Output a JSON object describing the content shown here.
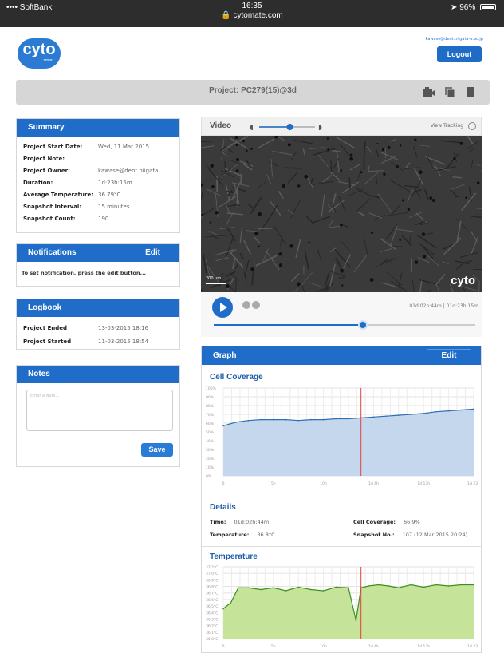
{
  "status_bar": {
    "carrier": "•••• SoftBank",
    "time": "16:35",
    "url": "cytomate.com",
    "battery": "96%"
  },
  "header": {
    "logo_text": "cyto",
    "logo_sub": "smart",
    "user_email": "kawase@dent.niigata-u.ac.jp",
    "logout_label": "Logout"
  },
  "project": {
    "title": "Project: PC279(15)@3d",
    "icons": [
      "camera-icon",
      "copy-icon",
      "trash-icon"
    ]
  },
  "summary": {
    "title": "Summary",
    "rows": [
      {
        "k": "Project Start Date:",
        "v": "Wed, 11 Mar 2015"
      },
      {
        "k": "Project Note:",
        "v": ""
      },
      {
        "k": "Project Owner:",
        "v": "kawase@dent.niigata..."
      },
      {
        "k": "Duration:",
        "v": "1d:23h:15m"
      },
      {
        "k": "Average Temperature:",
        "v": "36.79°C"
      },
      {
        "k": "Snapshot Interval:",
        "v": "15 minutes"
      },
      {
        "k": "Snapshot Count:",
        "v": "190"
      }
    ]
  },
  "notifications": {
    "title": "Notifications",
    "edit": "Edit",
    "message": "To set notification, press the edit button..."
  },
  "logbook": {
    "title": "Logbook",
    "rows": [
      {
        "k": "Project Ended",
        "v": "13-03-2015 18:16"
      },
      {
        "k": "Project Started",
        "v": "11-03-2015 18:54"
      }
    ]
  },
  "notes": {
    "title": "Notes",
    "placeholder": "Enter a Note...",
    "save": "Save"
  },
  "video": {
    "label": "Video",
    "view_tracking": "View Tracking",
    "scale_label": "200 µm",
    "timecode": "01d:02h:44m | 01d:23h:15m",
    "progress": 0.57,
    "speed": 0.55
  },
  "graph": {
    "title": "Graph",
    "edit": "Edit",
    "coverage_title": "Cell Coverage",
    "details_title": "Details",
    "details": [
      {
        "k": "Time:",
        "v": "01d:02h:44m"
      },
      {
        "k": "Cell Coverage:",
        "v": "66.9%"
      },
      {
        "k": "Temperature:",
        "v": "36.8°C"
      },
      {
        "k": "Snapshot No.:",
        "v": "107 (12 Mar 2015 20:24)"
      }
    ],
    "temperature_title": "Temperature"
  },
  "chart_data": [
    {
      "type": "area",
      "title": "Cell Coverage",
      "ylim": [
        0,
        100
      ],
      "y_ticks": [
        "100%",
        "90%",
        "80%",
        "70%",
        "60%",
        "50%",
        "40%",
        "30%",
        "20%",
        "10%",
        "0%"
      ],
      "x_ticks": [
        "0",
        "5h",
        "10h",
        "1d 4h",
        "1d 13h",
        "1d 23h"
      ],
      "x": [
        0,
        0.05,
        0.1,
        0.15,
        0.2,
        0.25,
        0.3,
        0.35,
        0.4,
        0.45,
        0.5,
        0.55,
        0.6,
        0.65,
        0.7,
        0.75,
        0.8,
        0.85,
        0.9,
        0.95,
        1.0
      ],
      "values": [
        57,
        61,
        63,
        64,
        64,
        64,
        63,
        64,
        64,
        65,
        65,
        66,
        67,
        68,
        69,
        70,
        71,
        73,
        74,
        75,
        76
      ],
      "marker_x": 0.55,
      "color": "#2f6fb5",
      "fill": "#c5d7ec",
      "grid": true
    },
    {
      "type": "area",
      "title": "Temperature",
      "ylim": [
        36.0,
        37.2
      ],
      "y_ticks": [
        "37.2°C",
        "37.0°C",
        "36.9°C",
        "36.8°C",
        "36.7°C",
        "36.6°C",
        "36.5°C",
        "36.4°C",
        "36.3°C",
        "36.2°C",
        "36.1°C",
        "36.0°C"
      ],
      "x_ticks": [
        "0",
        "5h",
        "10h",
        "1d 4h",
        "1d 13h",
        "1d 23h"
      ],
      "x": [
        0,
        0.03,
        0.06,
        0.1,
        0.15,
        0.2,
        0.25,
        0.3,
        0.35,
        0.4,
        0.45,
        0.5,
        0.53,
        0.55,
        0.58,
        0.62,
        0.66,
        0.7,
        0.75,
        0.8,
        0.85,
        0.9,
        0.95,
        1.0
      ],
      "values": [
        36.5,
        36.6,
        36.85,
        36.85,
        36.82,
        36.85,
        36.8,
        36.86,
        36.82,
        36.8,
        36.86,
        36.85,
        36.3,
        36.85,
        36.88,
        36.9,
        36.88,
        36.85,
        36.9,
        36.86,
        36.9,
        36.88,
        36.9,
        36.9
      ],
      "marker_x": 0.55,
      "color": "#3d8f1e",
      "fill": "#c6e39a",
      "grid": true
    }
  ]
}
